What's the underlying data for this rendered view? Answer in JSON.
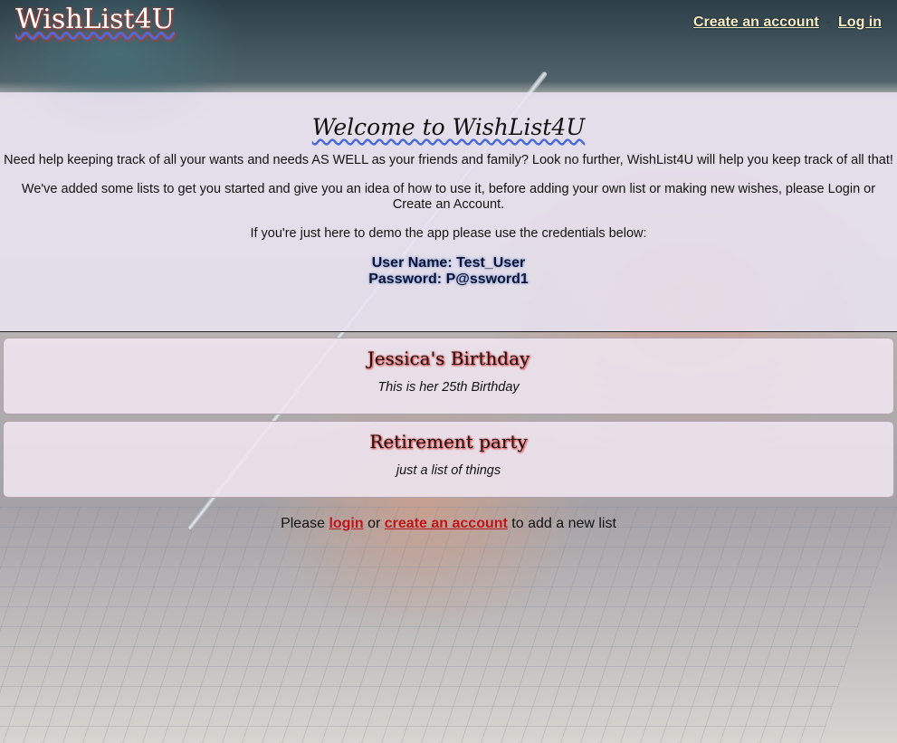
{
  "header": {
    "brand": "WishList4U",
    "nav": {
      "create_account": "Create an account",
      "separator": "-",
      "log_in": "Log in"
    }
  },
  "welcome": {
    "title": "Welcome to WishList4U",
    "paragraphs": [
      "Need help keeping track of all your wants and needs AS WELL as your friends and family? Look no further, WishList4U will help you keep track of all that!",
      "We've added some lists to get you started and give you an idea of how to use it, before adding your own list or making new wishes, please Login or Create an Account.",
      "If you're just here to demo the app please use the credentials below:"
    ],
    "credentials": {
      "username_line": "User Name: Test_User",
      "password_line": "Password: P@ssword1"
    }
  },
  "lists": [
    {
      "title": "Jessica's Birthday",
      "description": "This is her 25th Birthday"
    },
    {
      "title": "Retirement party",
      "description": "just a list of things"
    }
  ],
  "footer": {
    "prefix": "Please ",
    "login_link": "login",
    "middle": " or ",
    "create_link": "create an account",
    "suffix": " to add a new list"
  }
}
